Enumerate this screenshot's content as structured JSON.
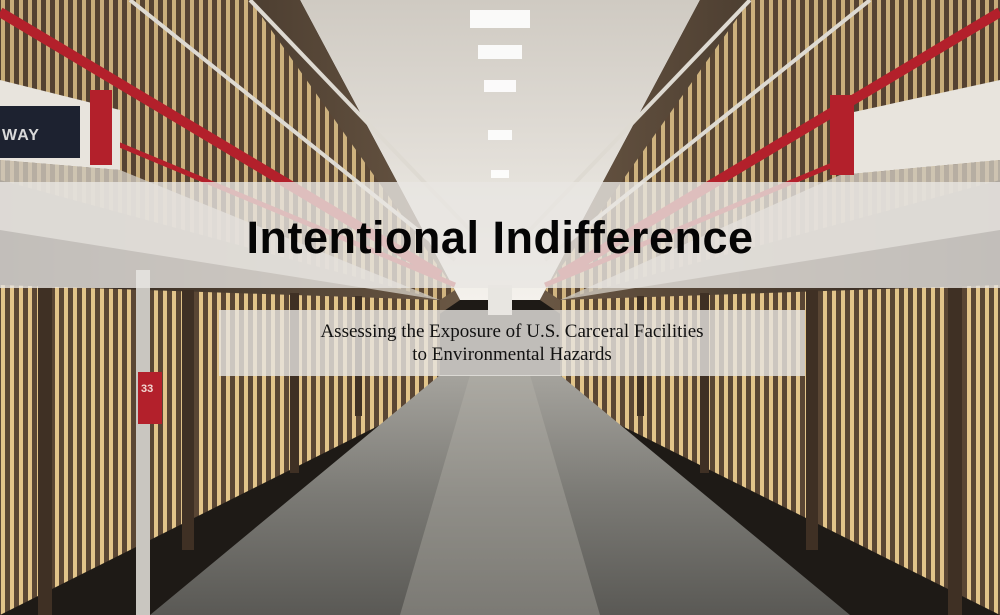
{
  "banner": {
    "title": "Intentional Indifference",
    "subtitle_line_1": "Assessing the Exposure of U.S. Carceral Facilities",
    "subtitle_line_2": "to Environmental Hazards"
  },
  "photo": {
    "sign_text": "WAY",
    "cell_number": "33",
    "colors": {
      "floor": "#7b7b77",
      "bars": "#e6c98f",
      "rail_red": "#b3202b",
      "ceiling": "#e9e6e0",
      "wall": "#3b2f26"
    }
  }
}
